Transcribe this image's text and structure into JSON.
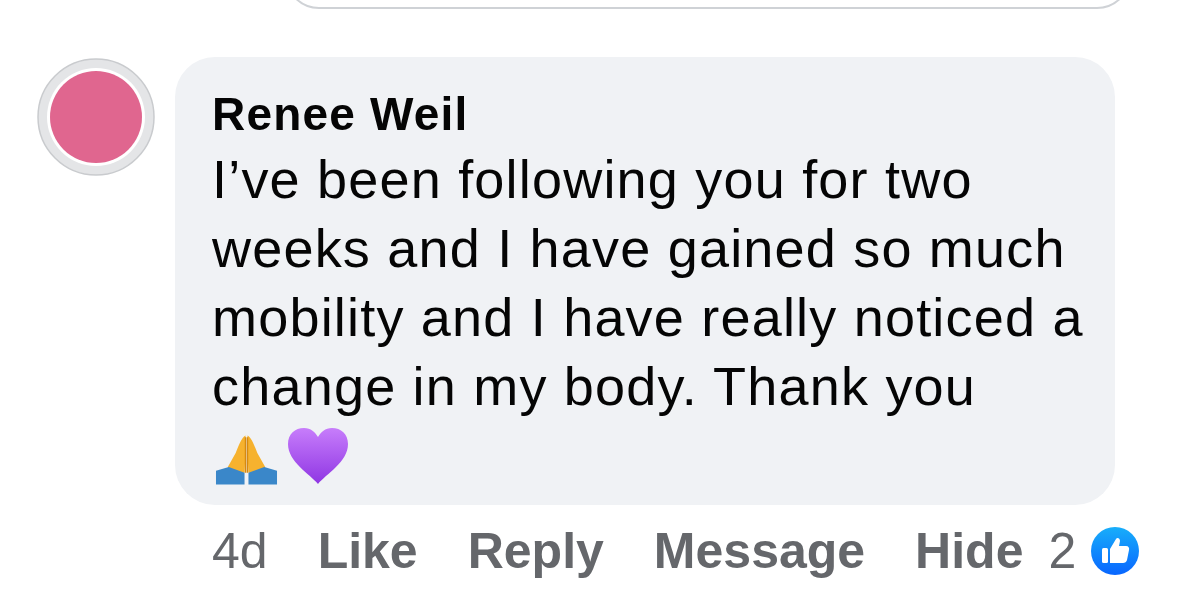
{
  "comment": {
    "author": "Renee Weil",
    "text": "I’ve been following you for two weeks and I have gained so much mobility and I have really noticed a change in my body. Thank you",
    "emojis": [
      {
        "kind": "praying-hands"
      },
      {
        "kind": "heart"
      }
    ]
  },
  "actions": {
    "time": "4d",
    "buttons": [
      "Like",
      "Reply",
      "Message",
      "Hide"
    ],
    "reaction_count": "2"
  }
}
